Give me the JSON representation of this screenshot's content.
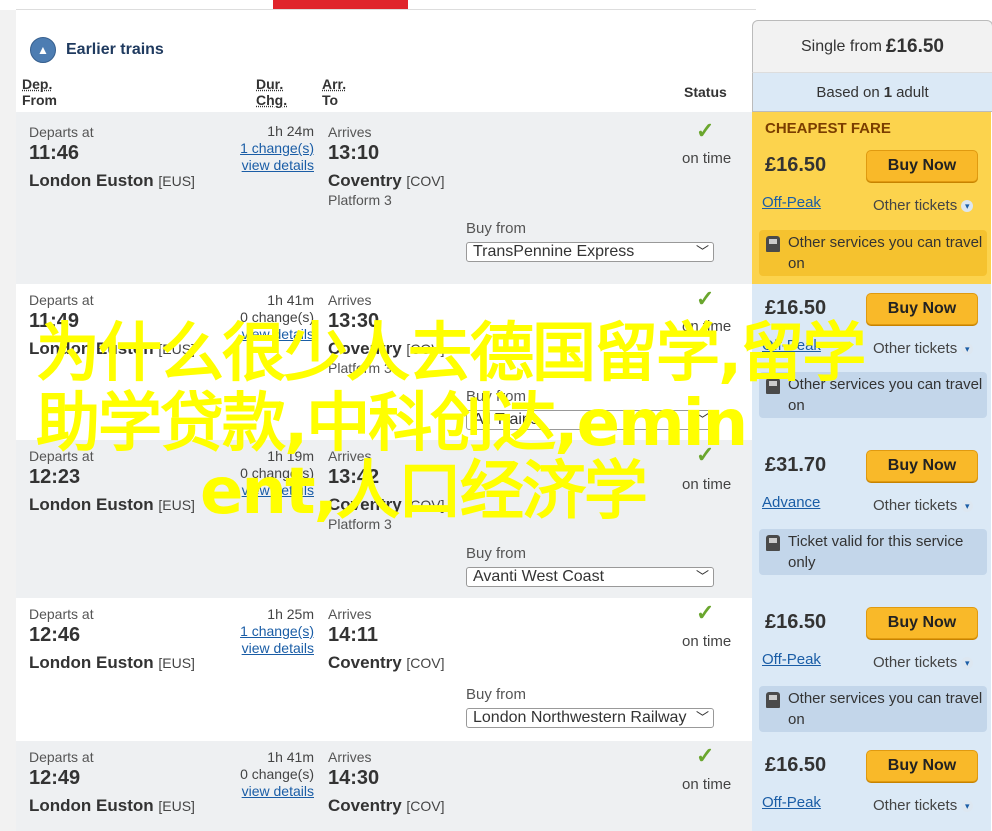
{
  "nav": {
    "earlier_label": "Earlier trains"
  },
  "columns": {
    "dep_line1": "Dep.",
    "dep_line2": "From",
    "dur_line1": "Dur.",
    "dur_line2": "Chg.",
    "arr_line1": "Arr.",
    "arr_line2": "To",
    "status": "Status"
  },
  "fare_header": {
    "single_from_prefix": "Single from",
    "single_from_price": "£16.50",
    "based_on_prefix": "Based on",
    "based_on_count": "1",
    "based_on_suffix": "adult"
  },
  "cheapest_label": "CHEAPEST FARE",
  "common": {
    "departs_at": "Departs at",
    "arrives": "Arrives",
    "buy_from": "Buy from",
    "buy_now": "Buy Now",
    "other_tickets": "Other tickets",
    "view_details": "view details",
    "check": "✓"
  },
  "journeys": [
    {
      "dep_time": "11:46",
      "dep_station": "London Euston",
      "dep_code": "[EUS]",
      "duration": "1h 24m",
      "changes": "1 change(s)",
      "arr_time": "13:10",
      "arr_station": "Coventry",
      "arr_code": "[COV]",
      "platform": "Platform 3",
      "status": "on time",
      "buy_from_operator": "TransPennine Express",
      "price": "£16.50",
      "ticket_type": "Off-Peak",
      "info": "Other services you can travel on"
    },
    {
      "dep_time": "11:49",
      "dep_station": "London Euston",
      "dep_code": "[EUS]",
      "duration": "1h 41m",
      "changes": "0 change(s)",
      "arr_time": "13:30",
      "arr_station": "Coventry",
      "arr_code": "[COV]",
      "platform": "Platform 3",
      "status": "on time",
      "buy_from_operator": "All Trains",
      "price": "£16.50",
      "ticket_type": "Off-Peak",
      "info": "Other services you can travel on"
    },
    {
      "dep_time": "12:23",
      "dep_station": "London Euston",
      "dep_code": "[EUS]",
      "duration": "1h 19m",
      "changes": "0 change(s)",
      "arr_time": "13:42",
      "arr_station": "Coventry",
      "arr_code": "[COV]",
      "platform": "Platform 3",
      "status": "on time",
      "buy_from_operator": "Avanti West Coast",
      "price": "£31.70",
      "ticket_type": "Advance",
      "info": "Ticket valid for this service only"
    },
    {
      "dep_time": "12:46",
      "dep_station": "London Euston",
      "dep_code": "[EUS]",
      "duration": "1h 25m",
      "changes": "1 change(s)",
      "arr_time": "14:11",
      "arr_station": "Coventry",
      "arr_code": "[COV]",
      "platform": "",
      "status": "on time",
      "buy_from_operator": "London Northwestern Railway",
      "price": "£16.50",
      "ticket_type": "Off-Peak",
      "info": "Other services you can travel on"
    },
    {
      "dep_time": "12:49",
      "dep_station": "London Euston",
      "dep_code": "[EUS]",
      "duration": "1h 41m",
      "changes": "0 change(s)",
      "arr_time": "14:30",
      "arr_station": "Coventry",
      "arr_code": "[COV]",
      "platform": "",
      "status": "on time",
      "buy_from_operator": "",
      "price": "£16.50",
      "ticket_type": "Off-Peak",
      "info": ""
    }
  ],
  "overlay": {
    "line1": "为什么很少人去德国留学,留学",
    "line2": "助学贷款,中科创达,emin",
    "line3": "ent,人口经济学"
  },
  "colors": {
    "accent_red": "#e0242b",
    "cheapest_bg": "#fcd34d",
    "buy_button": "#f9b929",
    "link_blue": "#1a5da6",
    "overlay_text": "#ffff00"
  }
}
